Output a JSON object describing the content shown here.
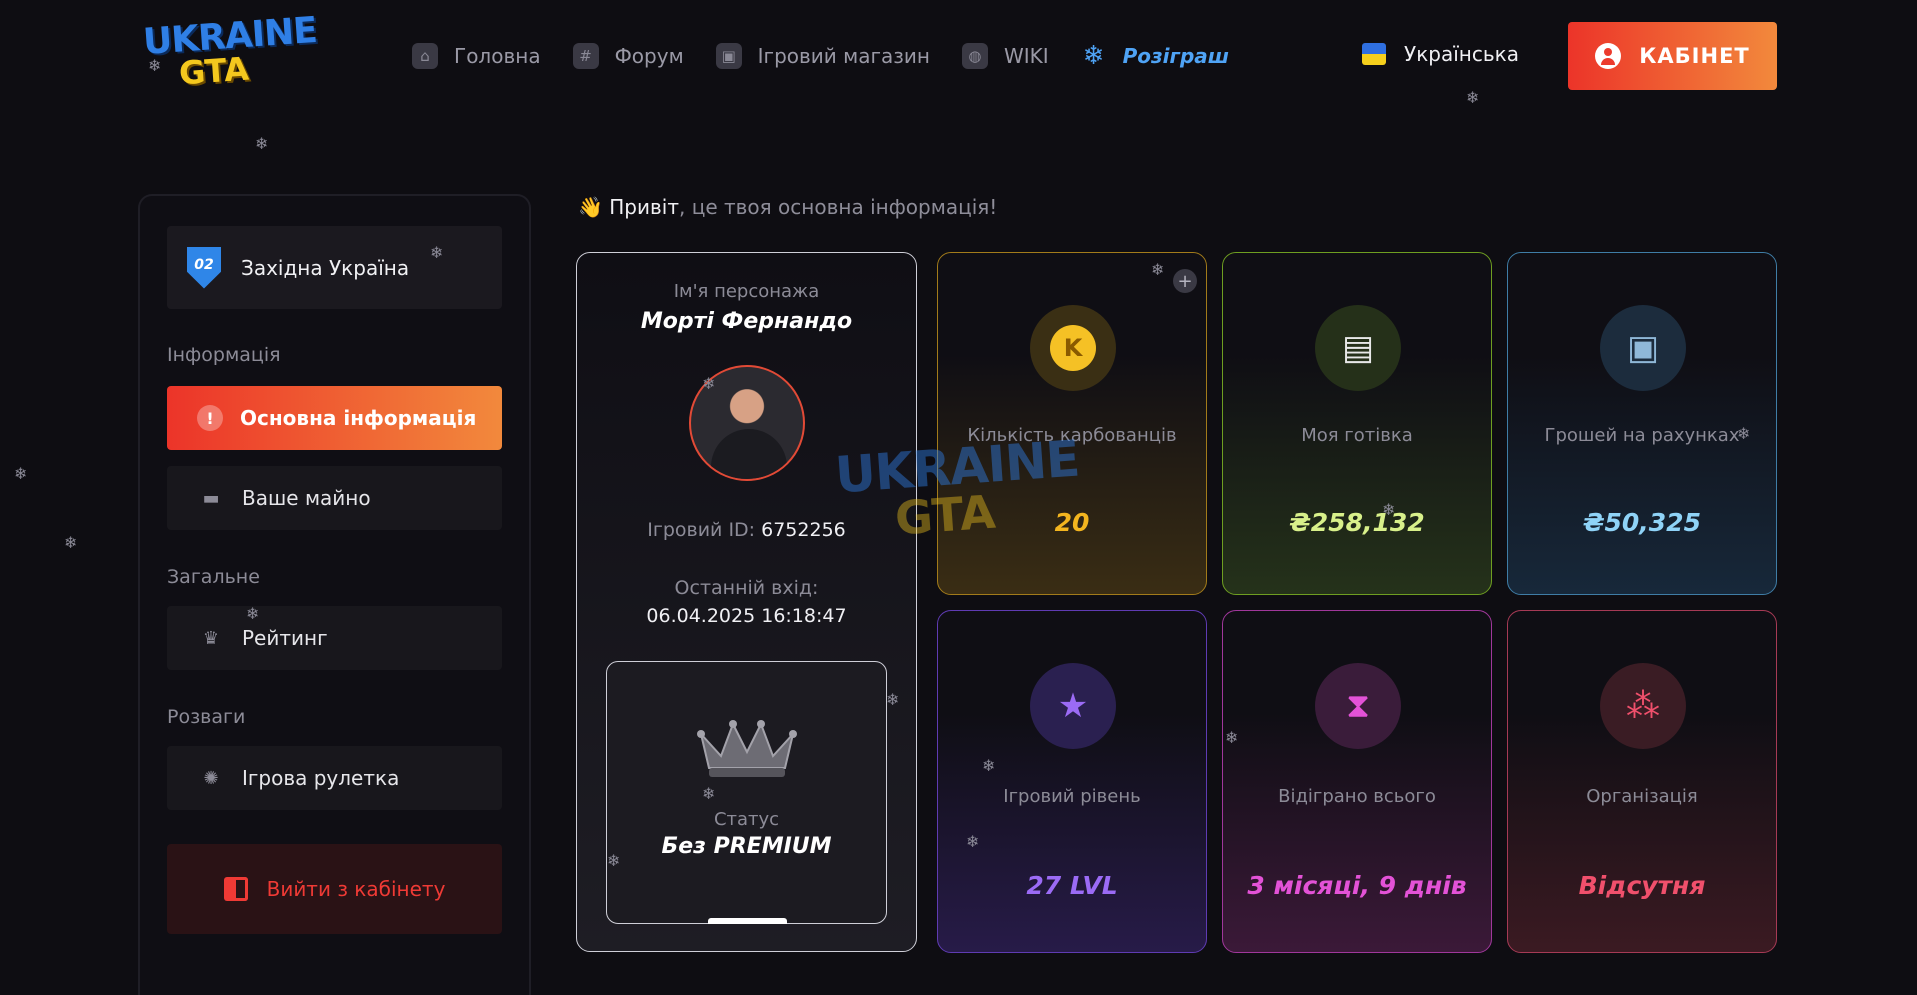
{
  "logo": {
    "line1": "UKRAINE",
    "line2": "GTA"
  },
  "nav": {
    "items": [
      {
        "label": "Головна",
        "icon": "home-icon",
        "glyph": "⌂"
      },
      {
        "label": "Форум",
        "icon": "hash-icon",
        "glyph": "#"
      },
      {
        "label": "Ігровий магазин",
        "icon": "bag-icon",
        "glyph": "▣"
      },
      {
        "label": "WIKI",
        "icon": "globe-icon",
        "glyph": "◍"
      },
      {
        "label": "Розіграш",
        "icon": "snowflake-icon",
        "glyph": "❄"
      }
    ]
  },
  "header": {
    "language": "Українська",
    "cabinet_label": "КАБІНЕТ"
  },
  "sidebar": {
    "server_number": "02",
    "server_name": "Західна Україна",
    "sections": [
      "Інформація",
      "Загальне",
      "Розваги"
    ],
    "items": [
      {
        "label": "Основна інформація",
        "icon": "alert-icon",
        "glyph": "!"
      },
      {
        "label": "Ваше майно",
        "icon": "car-icon",
        "glyph": "▬"
      },
      {
        "label": "Рейтинг",
        "icon": "trophy-icon",
        "glyph": "♛"
      },
      {
        "label": "Ігрова рулетка",
        "icon": "roulette-icon",
        "glyph": "✺"
      }
    ],
    "logout_label": "Вийти з кабінету"
  },
  "greeting": {
    "emoji": "👋",
    "highlight": "Привіт",
    "rest": ", це твоя основна інформація!"
  },
  "profile": {
    "name_label": "Ім'я персонажа",
    "name": "Морті Фернандо",
    "id_label": "Ігровий ID:",
    "id_value": "6752256",
    "last_login_label": "Останній вхід:",
    "last_login_value": "06.04.2025 16:18:47",
    "status_label": "Статус",
    "status_value": "Без PREMIUM"
  },
  "cards": {
    "coins": {
      "label": "Кількість карбованців",
      "value": "20",
      "icon": "coin-icon",
      "glyph": "K",
      "color": "#f3b51f"
    },
    "cash": {
      "label": "Моя готівка",
      "value": "₴258,132",
      "icon": "cash-stack-icon",
      "glyph": "▤",
      "color": "#d8f08a"
    },
    "bank": {
      "label": "Грошей на рахунках",
      "value": "₴50,325",
      "icon": "safe-icon",
      "glyph": "▣",
      "color": "#8fd3f7"
    },
    "level": {
      "label": "Ігровий рівень",
      "value": "27 LVL",
      "icon": "star-icon",
      "glyph": "★",
      "color": "#9b6bf5"
    },
    "played": {
      "label": "Відіграно всього",
      "value": "3 місяці, 9 днів",
      "icon": "hourglass-icon",
      "glyph": "⧗",
      "color": "#e352d7"
    },
    "org": {
      "label": "Організація",
      "value": "Відсутня",
      "icon": "group-icon",
      "glyph": "⁂",
      "color": "#f0506c"
    }
  },
  "watermark": {
    "line1": "UKRAINE",
    "line2": "GTA"
  }
}
